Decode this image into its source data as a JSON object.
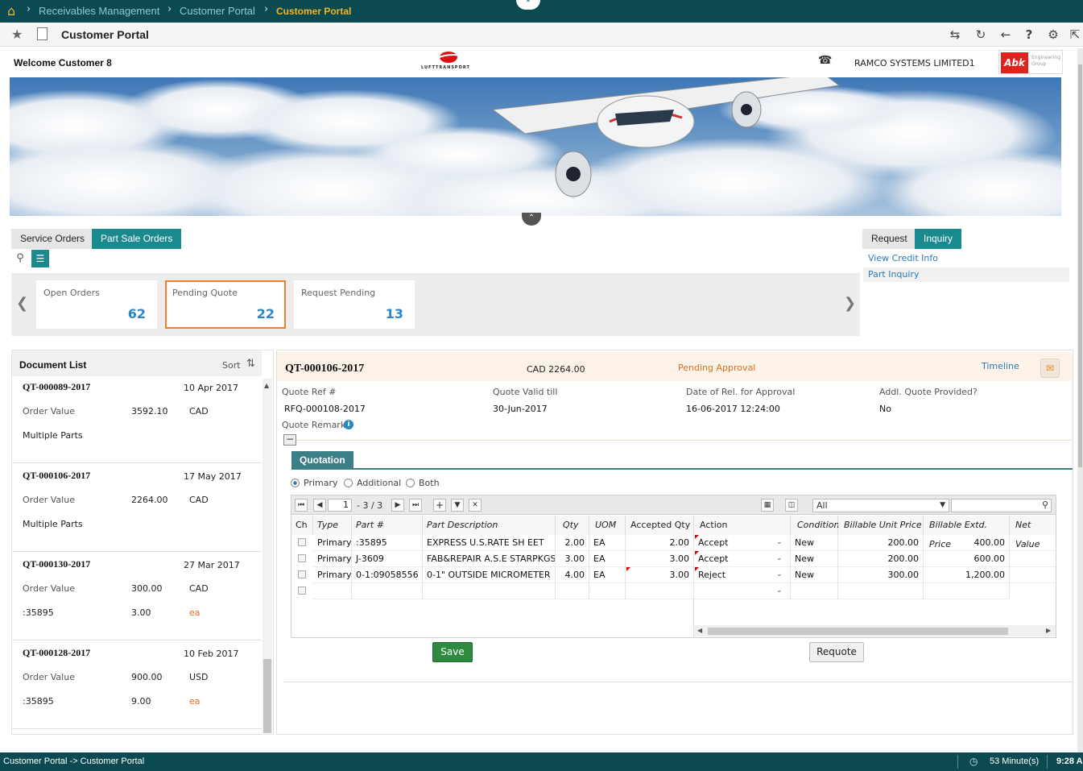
{
  "breadcrumb": {
    "items": [
      "Receivables Management",
      "Customer Portal",
      "Customer Portal"
    ]
  },
  "titlebar": {
    "title": "Customer Portal"
  },
  "welcome": {
    "text": "Welcome Customer 8",
    "company": "RAMCO SYSTEMS LIMITED1",
    "logo_text": "LUFTTRANSPORT",
    "partner_logo": "Abk",
    "partner_logo_sub": "Engineering Group"
  },
  "tabs": {
    "left": [
      "Service Orders",
      "Part Sale Orders"
    ],
    "active_left": "Part Sale Orders",
    "right": [
      "Request",
      "Inquiry"
    ],
    "active_right": "Inquiry"
  },
  "right_links": [
    "View Credit Info",
    "Part Inquiry"
  ],
  "cards": [
    {
      "label": "Open Orders",
      "value": "62"
    },
    {
      "label": "Pending Quote",
      "value": "22"
    },
    {
      "label": "Request Pending",
      "value": "13"
    }
  ],
  "doclist": {
    "title": "Document List",
    "sort_label": "Sort",
    "items": [
      {
        "id": "QT-000089-2017",
        "date": "10 Apr 2017",
        "label1": "Order Value",
        "value1": "3592.10",
        "cur1": "CAD",
        "label2": "Multiple Parts",
        "value2": "",
        "cur2": ""
      },
      {
        "id": "QT-000106-2017",
        "date": "17 May 2017",
        "label1": "Order Value",
        "value1": "2264.00",
        "cur1": "CAD",
        "label2": "Multiple Parts",
        "value2": "",
        "cur2": ""
      },
      {
        "id": "QT-000130-2017",
        "date": "27 Mar 2017",
        "label1": "Order Value",
        "value1": "300.00",
        "cur1": "CAD",
        "label2": ":35895",
        "value2": "3.00",
        "cur2": "ea"
      },
      {
        "id": "QT-000128-2017",
        "date": "10 Feb 2017",
        "label1": "Order Value",
        "value1": "900.00",
        "cur1": "USD",
        "label2": ":35895",
        "value2": "9.00",
        "cur2": "ea"
      }
    ]
  },
  "detail": {
    "id": "QT-000106-2017",
    "amount": "CAD 2264.00",
    "status": "Pending Approval",
    "timeline_label": "Timeline",
    "fields": [
      {
        "label": "Quote Ref #",
        "value": "RFQ-000108-2017"
      },
      {
        "label": "Quote Valid till",
        "value": "30-Jun-2017"
      },
      {
        "label": "Date of Rel. for Approval",
        "value": "16-06-2017 12:24:00"
      },
      {
        "label": "Addl. Quote Provided?",
        "value": "No"
      }
    ],
    "remarks_label": "Quote Remarks",
    "quotation_tab": "Quotation",
    "radios": [
      "Primary",
      "Additional",
      "Both"
    ],
    "selected_radio": "Primary",
    "pager": {
      "page": "1",
      "range": "- 3 / 3"
    },
    "filter_value": "All",
    "columns": [
      "Ch",
      "Type",
      "Part #",
      "Part Description",
      "Qty",
      "UOM",
      "Accepted Qty",
      "Action",
      "Condition",
      "Billable Unit Price",
      "Billable Extd. Price",
      "Net Value"
    ],
    "rows": [
      {
        "type": "Primary",
        "part": ":35895",
        "desc": "EXPRESS U.S.RATE SH EET",
        "qty": "2.00",
        "uom": "EA",
        "acc": "2.00",
        "action": "Accept",
        "cond": "New",
        "unit": "200.00",
        "extd": "400.00",
        "net": ""
      },
      {
        "type": "Primary",
        "part": "J-3609",
        "desc": "FAB&REPAIR A.S.E STARPKGS",
        "qty": "3.00",
        "uom": "EA",
        "acc": "3.00",
        "action": "Accept",
        "cond": "New",
        "unit": "200.00",
        "extd": "600.00",
        "net": ""
      },
      {
        "type": "Primary",
        "part": "0-1:09058556",
        "desc": "0-1\" OUTSIDE MICROMETER",
        "qty": "4.00",
        "uom": "EA",
        "acc": "3.00",
        "action": "Reject",
        "cond": "New",
        "unit": "300.00",
        "extd": "1,200.00",
        "net": ""
      }
    ],
    "save_label": "Save",
    "requote_label": "Requote"
  },
  "statusbar": {
    "path": "Customer Portal -> Customer Portal",
    "session": "53 Minute(s)",
    "time": "9:28 A"
  },
  "colors": {
    "teal_dark": "#0c4a52",
    "teal": "#1b8a8f",
    "accent_orange": "#f07f2a",
    "link_blue": "#2a79b5",
    "save_green": "#2e8b3d"
  }
}
